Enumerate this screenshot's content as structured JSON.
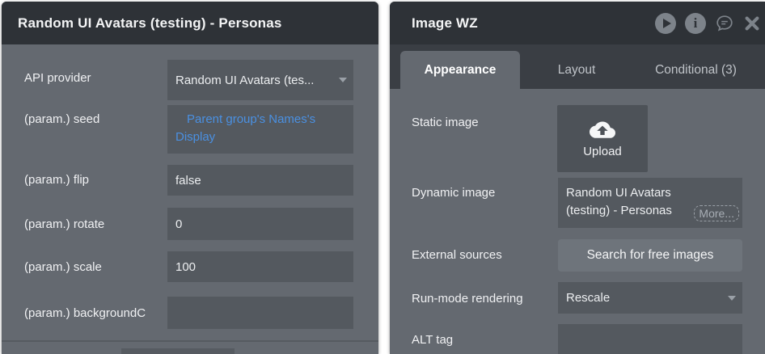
{
  "colors": {
    "accent_blue": "#4a90e2",
    "panel_header": "#2e3237",
    "panel_body": "#646970",
    "field_bg": "#54595f"
  },
  "left_panel": {
    "title": "Random UI Avatars (testing) - Personas",
    "rows": [
      {
        "label": "API provider",
        "value": "Random UI Avatars (tes..."
      },
      {
        "label": "(param.) seed",
        "value": "Parent group's Names's Display"
      },
      {
        "label": "(param.) flip",
        "value": "false"
      },
      {
        "label": "(param.) rotate",
        "value": "0"
      },
      {
        "label": "(param.) scale",
        "value": "100"
      },
      {
        "label": "(param.) backgroundC",
        "value": ""
      }
    ]
  },
  "right_panel": {
    "title": "Image WZ",
    "header_icons": [
      "play-icon",
      "info-icon",
      "comment-icon",
      "close-icon"
    ],
    "tabs": [
      {
        "label": "Appearance",
        "active": true
      },
      {
        "label": "Layout",
        "active": false
      },
      {
        "label": "Conditional (3)",
        "active": false
      }
    ],
    "rows": [
      {
        "label": "Static image",
        "button": "Upload"
      },
      {
        "label": "Dynamic image",
        "value": "Random UI Avatars (testing) - Personas",
        "more": "More..."
      },
      {
        "label": "External sources",
        "button": "Search for free images"
      },
      {
        "label": "Run-mode rendering",
        "value": "Rescale"
      },
      {
        "label": "ALT tag",
        "value": ""
      }
    ]
  }
}
